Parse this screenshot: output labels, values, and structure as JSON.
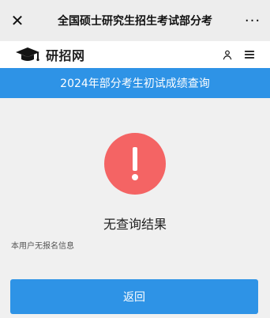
{
  "topbar": {
    "close_icon": "close-icon",
    "title": "全国硕士研究生招生考试部分考",
    "more_icon": "more-icon"
  },
  "site_header": {
    "brand_icon": "graduation-cap-icon",
    "brand_text": "研招网",
    "user_icon": "user-icon",
    "menu_icon": "menu-icon"
  },
  "banner": {
    "title": "2024年部分考生初试成绩查询"
  },
  "result": {
    "status_icon": "exclamation-icon",
    "status_color": "#f46464",
    "title": "无查询结果",
    "detail": "本用户无报名信息"
  },
  "actions": {
    "back_label": "返回"
  },
  "colors": {
    "primary": "#2e93e6",
    "background": "#f0f0f0",
    "topbar": "#ededed"
  }
}
